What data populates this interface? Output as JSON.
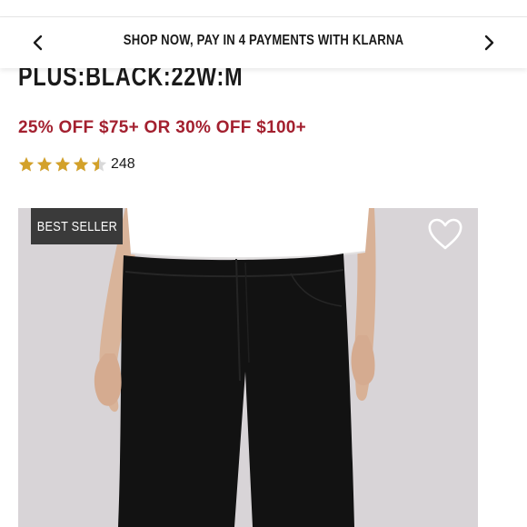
{
  "promo_bar": {
    "text": "SHOP NOW, PAY IN 4 PAYMENTS WITH KLARNA",
    "prev_icon": "chevron-left-icon",
    "next_icon": "chevron-right-icon"
  },
  "product": {
    "variant_title": "PLUS:BLACK:22W:M",
    "discount_text": "25% OFF $75+ OR 30% OFF $100+",
    "discount_color": "#a3202f",
    "rating": {
      "value": 4.5,
      "max": 5,
      "star_color": "#d3a12a",
      "review_count": "248"
    },
    "image": {
      "badge": "BEST SELLER",
      "wishlist_icon": "heart-icon"
    }
  }
}
